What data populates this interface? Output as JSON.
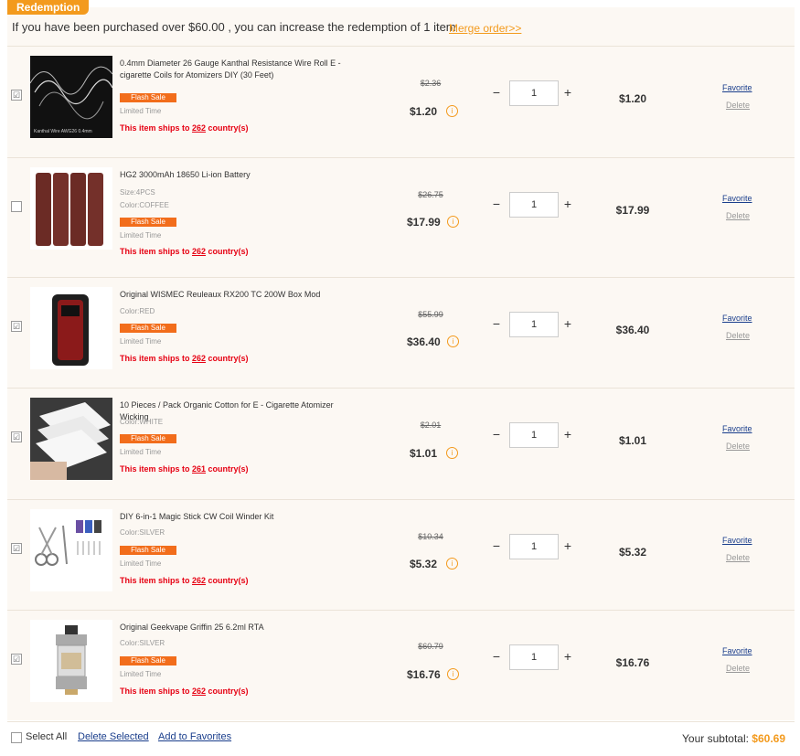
{
  "header": {
    "tag": "Redemption",
    "notice": "If you have been purchased over $60.00 , you can increase the redemption of 1 item",
    "merge_link": "Merge order>>"
  },
  "items": [
    {
      "title": "0.4mm Diameter 26 Gauge Kanthal Resistance Wire Roll E - cigarette Coils for Atomizers DIY (30 Feet)",
      "attr": "",
      "badge": "Flash Sale",
      "limited": "Limited Time",
      "ships_prefix": "This item ships to ",
      "ships_count": "262",
      "ships_suffix": " country(s)",
      "old_price": "$2.36",
      "price": "$1.20",
      "qty": "1",
      "total": "$1.20",
      "favorite": "Favorite",
      "delete": "Delete",
      "checked": "☑",
      "image_caption": "Kanthal Wire AWG26  0.4mm"
    },
    {
      "title": "HG2 3000mAh 18650 Li-ion Battery",
      "attr": "Size:4PCS",
      "attr2": "Color:COFFEE",
      "badge": "Flash Sale",
      "limited": "Limited Time",
      "ships_prefix": "This item ships to ",
      "ships_count": "262",
      "ships_suffix": " country(s)",
      "old_price": "$26.75",
      "price": "$17.99",
      "qty": "1",
      "total": "$17.99",
      "favorite": "Favorite",
      "delete": "Delete",
      "checked": ""
    },
    {
      "title": "Original WISMEC Reuleaux RX200 TC 200W Box Mod",
      "attr": "Color:RED",
      "badge": "Flash Sale",
      "limited": "Limited Time",
      "ships_prefix": "This item ships to ",
      "ships_count": "262",
      "ships_suffix": " country(s)",
      "old_price": "$55.99",
      "price": "$36.40",
      "qty": "1",
      "total": "$36.40",
      "favorite": "Favorite",
      "delete": "Delete",
      "checked": "☑"
    },
    {
      "title": "10 Pieces / Pack Organic Cotton for E - Cigarette Atomizer Wicking",
      "attr": "Color:WHITE",
      "badge": "Flash Sale",
      "limited": "Limited Time",
      "ships_prefix": "This item ships to ",
      "ships_count": "261",
      "ships_suffix": " country(s)",
      "old_price": "$2.01",
      "price": "$1.01",
      "qty": "1",
      "total": "$1.01",
      "favorite": "Favorite",
      "delete": "Delete",
      "checked": "☑"
    },
    {
      "title": "DIY 6-in-1 Magic Stick CW Coil Winder Kit",
      "attr": "Color:SILVER",
      "badge": "Flash Sale",
      "limited": "Limited Time",
      "ships_prefix": "This item ships to ",
      "ships_count": "262",
      "ships_suffix": " country(s)",
      "old_price": "$10.34",
      "price": "$5.32",
      "qty": "1",
      "total": "$5.32",
      "favorite": "Favorite",
      "delete": "Delete",
      "checked": "☑"
    },
    {
      "title": "Original Geekvape Griffin 25 6.2ml RTA",
      "attr": "Color:SILVER",
      "badge": "Flash Sale",
      "limited": "Limited Time",
      "ships_prefix": "This item ships to ",
      "ships_count": "262",
      "ships_suffix": " country(s)",
      "old_price": "$60.79",
      "price": "$16.76",
      "qty": "1",
      "total": "$16.76",
      "favorite": "Favorite",
      "delete": "Delete",
      "checked": "☑"
    }
  ],
  "footer": {
    "select_all": "Select All",
    "delete_selected": "Delete Selected",
    "add_to_favorites": "Add to Favorites",
    "subtotal_label": "Your subtotal: ",
    "subtotal_value": "$60.69"
  },
  "icons": {
    "info": "info-circle-icon",
    "minus": "minus-icon",
    "plus": "plus-icon"
  },
  "colors": {
    "accent": "#f39a1d",
    "flash": "#f26d1b",
    "ships": "#e60012",
    "link": "#1a3e8c"
  }
}
